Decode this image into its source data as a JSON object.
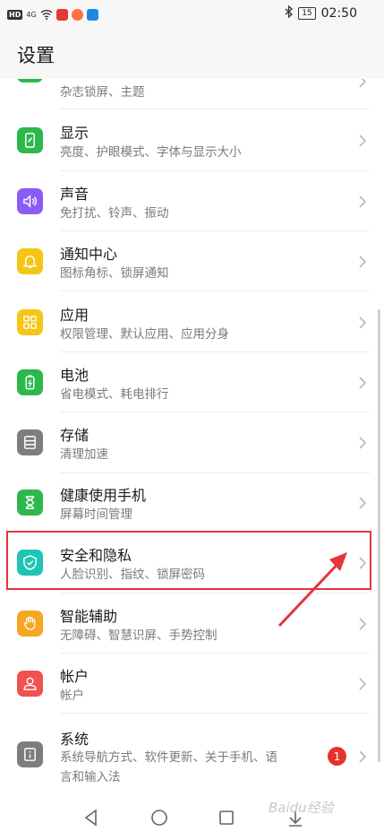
{
  "status_bar": {
    "hd": "HD",
    "network": "4G",
    "time": "02:50",
    "battery": "15"
  },
  "header": {
    "title": "设置"
  },
  "items": [
    {
      "title": "",
      "subtitle": "杂志锁屏、主题",
      "icon": "wallpaper-icon",
      "color": "#2db84c"
    },
    {
      "title": "显示",
      "subtitle": "亮度、护眼模式、字体与显示大小",
      "icon": "display-icon",
      "color": "#2db84c"
    },
    {
      "title": "声音",
      "subtitle": "免打扰、铃声、振动",
      "icon": "sound-icon",
      "color": "#8a5cf5"
    },
    {
      "title": "通知中心",
      "subtitle": "图标角标、锁屏通知",
      "icon": "bell-icon",
      "color": "#f5c518"
    },
    {
      "title": "应用",
      "subtitle": "权限管理、默认应用、应用分身",
      "icon": "apps-grid-icon",
      "color": "#f5c518"
    },
    {
      "title": "电池",
      "subtitle": "省电模式、耗电排行",
      "icon": "battery-icon",
      "color": "#2db84c"
    },
    {
      "title": "存储",
      "subtitle": "清理加速",
      "icon": "storage-icon",
      "color": "#7d7d7d"
    },
    {
      "title": "健康使用手机",
      "subtitle": "屏幕时间管理",
      "icon": "hourglass-icon",
      "color": "#2db84c"
    },
    {
      "title": "安全和隐私",
      "subtitle": "人脸识别、指纹、锁屏密码",
      "icon": "shield-icon",
      "color": "#1fc4b4"
    },
    {
      "title": "智能辅助",
      "subtitle": "无障碍、智慧识屏、手势控制",
      "icon": "hand-icon",
      "color": "#f5a623"
    },
    {
      "title": "帐户",
      "subtitle": "帐户",
      "icon": "account-icon",
      "color": "#f05151"
    },
    {
      "title": "系统",
      "subtitle_line1": "系统导航方式、软件更新、关于手机、语",
      "subtitle_line2": "言和输入法",
      "icon": "system-icon",
      "color": "#7d7d7d",
      "badge": "1"
    }
  ],
  "navbar": {
    "back": "back-icon",
    "home": "home-icon",
    "recents": "recents-icon"
  },
  "watermark": "Baidu经验"
}
